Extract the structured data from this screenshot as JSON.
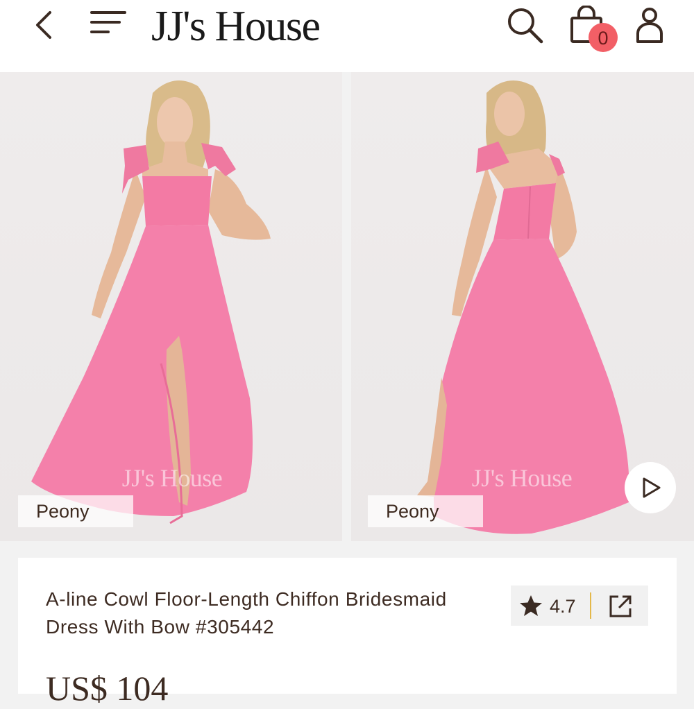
{
  "header": {
    "logo": "JJ's House",
    "back_icon": "chevron-left-icon",
    "menu_icon": "menu-icon",
    "search_icon": "search-icon",
    "bag_icon": "shopping-bag-icon",
    "cart_count": "0",
    "user_icon": "user-icon",
    "badge_color": "#f25f66"
  },
  "gallery": {
    "images": [
      {
        "color_label": "Peony",
        "watermark": "JJ's House",
        "view": "front"
      },
      {
        "color_label": "Peony",
        "watermark": "JJ's House",
        "view": "back"
      }
    ],
    "play_icon": "play-icon",
    "dress_color": "#f47fa7"
  },
  "product": {
    "title": "A-line Cowl Floor-Length Chiffon Bridesmaid Dress With Bow #305442",
    "rating": "4.7",
    "star_icon": "star-icon",
    "share_icon": "share-icon",
    "price": "US$ 104"
  }
}
